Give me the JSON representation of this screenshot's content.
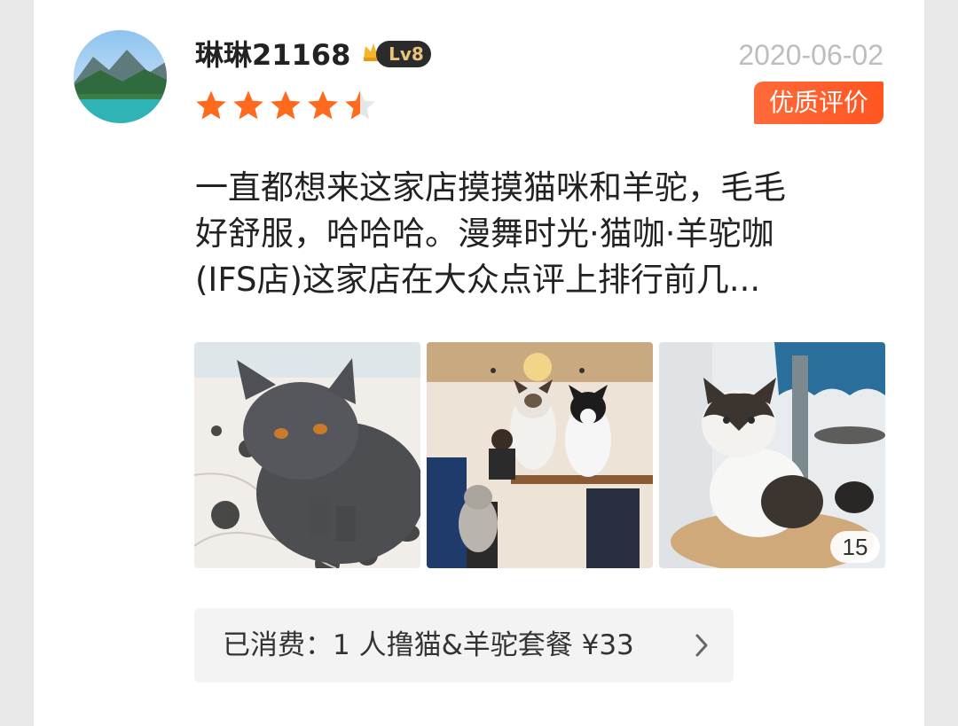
{
  "review": {
    "username": "琳琳21168",
    "level": "Lv8",
    "date": "2020-06-02",
    "rating": 4.5,
    "rating_max": 5,
    "quality_badge": "优质评价",
    "text_lines": [
      "一直都想来这家店摸摸猫咪和羊驼，毛毛",
      "好舒服，哈哈哈。漫舞时光·猫咖·羊驼咖",
      "(IFS店)这家店在大众点评上排行前几..."
    ],
    "photo_count": "15",
    "consumption": "已消费：1 人撸猫&羊驼套餐 ¥33"
  },
  "colors": {
    "star": "#ff6a1f",
    "badge": "#ff5a2a",
    "level_pill": "#2b2b2b"
  },
  "icons": [
    "avatar-image",
    "crown-icon",
    "star-icon",
    "chevron-right-icon"
  ]
}
